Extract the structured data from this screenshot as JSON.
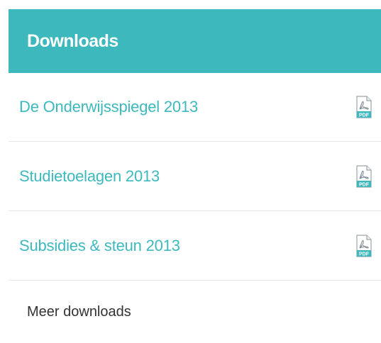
{
  "header": {
    "title": "Downloads"
  },
  "downloads": {
    "items": [
      {
        "label": "De Onderwijsspiegel 2013",
        "icon": "pdf-icon",
        "icon_text": "PDF"
      },
      {
        "label": "Studietoelagen 2013",
        "icon": "pdf-icon",
        "icon_text": "PDF"
      },
      {
        "label": "Subsidies & steun 2013",
        "icon": "pdf-icon",
        "icon_text": "PDF"
      }
    ]
  },
  "footer": {
    "more_label": "Meer downloads"
  },
  "colors": {
    "accent": "#3db8bd",
    "text_dark": "#333333",
    "divider": "#e6e6e6"
  }
}
